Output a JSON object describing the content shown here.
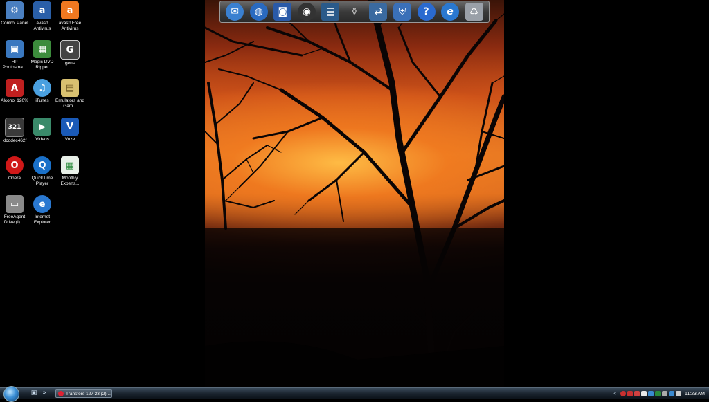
{
  "desktop": {
    "icons": [
      {
        "label": "Control Panel",
        "icon": "control-panel-icon",
        "color": "#4a7fc0",
        "glyph": "⚙"
      },
      {
        "label": "avast! Antivirus",
        "icon": "avast-antivirus-icon",
        "color": "#2a5fa8",
        "glyph": "a"
      },
      {
        "label": "avast! Free Antivirus",
        "icon": "avast-free-antivirus-icon",
        "color": "#f07820",
        "glyph": "a"
      },
      {
        "label": "HP Photosma...",
        "icon": "hp-photosmart-icon",
        "color": "#3a78c0",
        "glyph": "▣"
      },
      {
        "label": "Magic DVD Ripper",
        "icon": "magic-dvd-ripper-icon",
        "color": "#3c8c3c",
        "glyph": "▦"
      },
      {
        "label": "gens",
        "icon": "gens-icon",
        "color": "#444444",
        "glyph": "G"
      },
      {
        "label": "Alcohol 120%",
        "icon": "alcohol-120-icon",
        "color": "#c02020",
        "glyph": "A"
      },
      {
        "label": "iTunes",
        "icon": "itunes-icon",
        "color": "#4aa0e0",
        "glyph": "♫"
      },
      {
        "label": "Emulators and Gam...",
        "icon": "folder-icon",
        "color": "#d8c070",
        "glyph": "▤"
      },
      {
        "label": "klcodec462f",
        "icon": "klcodec-icon",
        "color": "#3a3a3a",
        "glyph": "321"
      },
      {
        "label": "Videos",
        "icon": "videos-icon",
        "color": "#3a8a6a",
        "glyph": "▶"
      },
      {
        "label": "Vuze",
        "icon": "vuze-icon",
        "color": "#1a5ab8",
        "glyph": "V"
      },
      {
        "label": "Opera",
        "icon": "opera-icon",
        "color": "#d01818",
        "glyph": "O"
      },
      {
        "label": "QuickTime Player",
        "icon": "quicktime-icon",
        "color": "#1a70c8",
        "glyph": "Q"
      },
      {
        "label": "Monthly Expens...",
        "icon": "spreadsheet-icon",
        "color": "#2a8a3a",
        "glyph": "▦"
      },
      {
        "label": "FreeAgent Drive (I) ...",
        "icon": "drive-icon",
        "color": "#8a8a8a",
        "glyph": "▭"
      },
      {
        "label": "Internet Explorer",
        "icon": "internet-explorer-icon",
        "color": "#2a78d0",
        "glyph": "e"
      }
    ]
  },
  "dock": {
    "items": [
      {
        "icon": "mail-icon",
        "color": "#3a80d0",
        "glyph": "✉"
      },
      {
        "icon": "globe-icon",
        "color": "#2a6ac0",
        "glyph": "◍"
      },
      {
        "icon": "camera-icon",
        "color": "#2a5aa8",
        "glyph": "◙"
      },
      {
        "icon": "speaker-icon",
        "color": "#333333",
        "glyph": "◉"
      },
      {
        "icon": "video-clapper-icon",
        "color": "#2a5a8a",
        "glyph": "▤"
      },
      {
        "icon": "recycle-full-icon",
        "color": "#666666",
        "glyph": "⚱"
      },
      {
        "icon": "network-icon",
        "color": "#3a6aa0",
        "glyph": "⇄"
      },
      {
        "icon": "shield-icon",
        "color": "#3a70b8",
        "glyph": "⛨"
      },
      {
        "icon": "help-icon",
        "color": "#2a6ad0",
        "glyph": "?"
      },
      {
        "icon": "internet-explorer-icon",
        "color": "#2a78d0",
        "glyph": "e"
      },
      {
        "icon": "recycle-bin-icon",
        "color": "#9aa0a8",
        "glyph": "♺"
      }
    ]
  },
  "taskbar": {
    "task_button_label": "Transfers 127 23 (2) ...",
    "clock": "11:23 AM",
    "tray_colors": [
      "#c83030",
      "#c83030",
      "#d04040",
      "#e8e8e8",
      "#3a8ad0",
      "#2a8a3a",
      "#aaaaaa",
      "#3a8ad0",
      "#cccccc"
    ]
  },
  "colors": {
    "desktop_background": "#000000",
    "taskbar": "#1a242e"
  }
}
